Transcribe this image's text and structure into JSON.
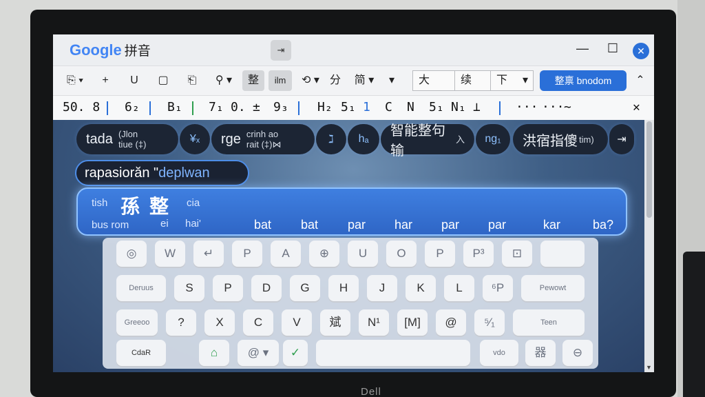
{
  "app": {
    "logo": "Google",
    "name": "拼音",
    "mid_button": "⇥"
  },
  "window": {
    "minimize": "—",
    "maximize": "☐",
    "close": "✕"
  },
  "toolbar": {
    "tools": [
      "⎘ ▾",
      "+",
      "U",
      "▢",
      "⎗",
      "⚲ ▾",
      "整",
      "ilm",
      "⟲ ▾",
      "分",
      "简 ▾",
      "▾"
    ],
    "font_size": "大",
    "font_name": "续",
    "font_pos": "下",
    "font_arrow": "▾",
    "primary_label": "整禀 bnodom",
    "collapse": "⌃"
  },
  "candidates_strip": {
    "items": [
      "50. 8",
      "6₂",
      "B₁",
      "7₁",
      "0.",
      "±",
      "9₃",
      "H₂",
      "5₁",
      "1",
      "C",
      "N",
      "5₁",
      "N₁",
      "⊥"
    ],
    "more": [
      "···",
      "···",
      "~"
    ],
    "close": "✕"
  },
  "chips": [
    {
      "main": "tada",
      "sub": "(Jlon\ntiue (‡)"
    },
    {
      "main": "¥ₓ",
      "sub": ""
    },
    {
      "main": "rge",
      "sub": "crinh ao\nrait (‡)⋈"
    },
    {
      "main": "ℷ",
      "sub": ""
    },
    {
      "main": "hₐ",
      "sub": ""
    },
    {
      "main": "智能整句输",
      "sub": "入"
    },
    {
      "main": "ng₁",
      "sub": ""
    },
    {
      "main": "洪宿指傻",
      "sub": "tim)"
    },
    {
      "main": "⇥",
      "sub": ""
    }
  ],
  "composition": {
    "text": "rapasiorăn \"",
    "highlight": "deplwan"
  },
  "panel": {
    "label_top": "tish",
    "label_bot": "bus rom",
    "big1": "孫",
    "big2": "整",
    "extra_top": "cia",
    "extra_bot": "ei",
    "hai": "hai'",
    "words": [
      "bat",
      "bat",
      "par",
      "har",
      "par",
      "par",
      "kar",
      "ba?"
    ]
  },
  "keyboard": {
    "row1": [
      "◎",
      "W",
      "↵",
      "P",
      "A",
      "⊕",
      "U",
      "O",
      "P",
      "P³",
      "⊡",
      ""
    ],
    "row2": [
      "Deruus",
      "S",
      "P",
      "D",
      "G",
      "H",
      "J",
      "K",
      "L",
      "⁶P",
      "Pewowt"
    ],
    "row3": [
      "Greeoo",
      "?",
      "X",
      "C",
      "V",
      "斌",
      "N¹",
      "[M]",
      "@",
      "⁵⁄₁",
      "Teen"
    ],
    "row4": [
      "CdaR",
      "⌂",
      "@ ▾",
      "✓",
      "",
      "vdo",
      "器",
      "⊖",
      "···"
    ]
  },
  "brand": "Dell"
}
